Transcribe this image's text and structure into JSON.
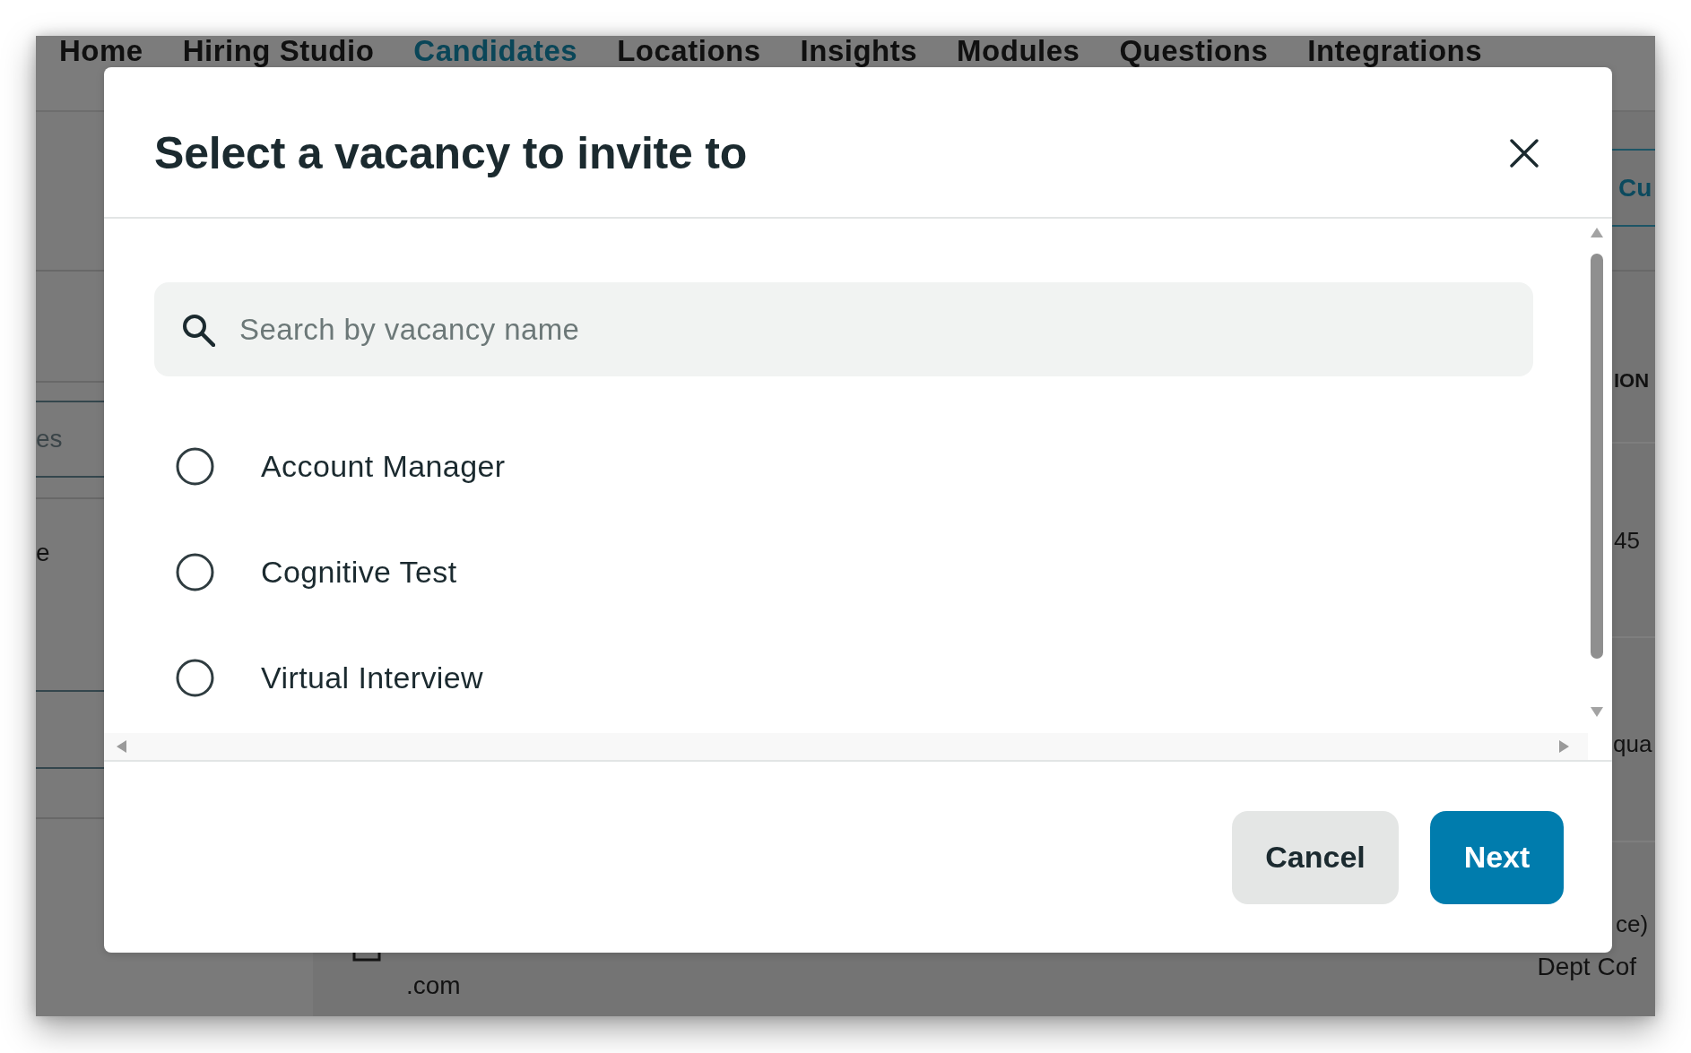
{
  "backdrop": {
    "nav": [
      {
        "label": "Home",
        "selected": false
      },
      {
        "label": "Hiring Studio",
        "selected": false
      },
      {
        "label": "Candidates",
        "selected": true
      },
      {
        "label": "Locations",
        "selected": false
      },
      {
        "label": "Insights",
        "selected": false
      },
      {
        "label": "Modules",
        "selected": false
      },
      {
        "label": "Questions",
        "selected": false
      },
      {
        "label": "Integrations",
        "selected": false
      }
    ],
    "left_column": [
      {
        "text": "es",
        "kind": "muted"
      },
      {
        "text": "e",
        "kind": "plain"
      }
    ],
    "right_column": [
      {
        "text": "Cu",
        "kind": "accent"
      },
      {
        "text": "ION",
        "kind": "heading"
      },
      {
        "text": "45",
        "kind": "plain"
      },
      {
        "text": "qua",
        "kind": "plain"
      },
      {
        "text": "ce)",
        "kind": "plain"
      }
    ],
    "bottom_row": [
      {
        "text": ".com",
        "kind": "plain"
      },
      {
        "text": "Dept Cof",
        "kind": "plain"
      }
    ]
  },
  "dialog": {
    "title": "Select a vacancy to invite to",
    "search": {
      "placeholder": "Search by vacancy name"
    },
    "options": [
      {
        "label": "Account Manager",
        "selected": false
      },
      {
        "label": "Cognitive Test",
        "selected": false
      },
      {
        "label": "Virtual Interview",
        "selected": false
      }
    ],
    "buttons": [
      {
        "label": "Cancel",
        "kind": "secondary"
      },
      {
        "label": "Next",
        "kind": "primary"
      }
    ]
  }
}
